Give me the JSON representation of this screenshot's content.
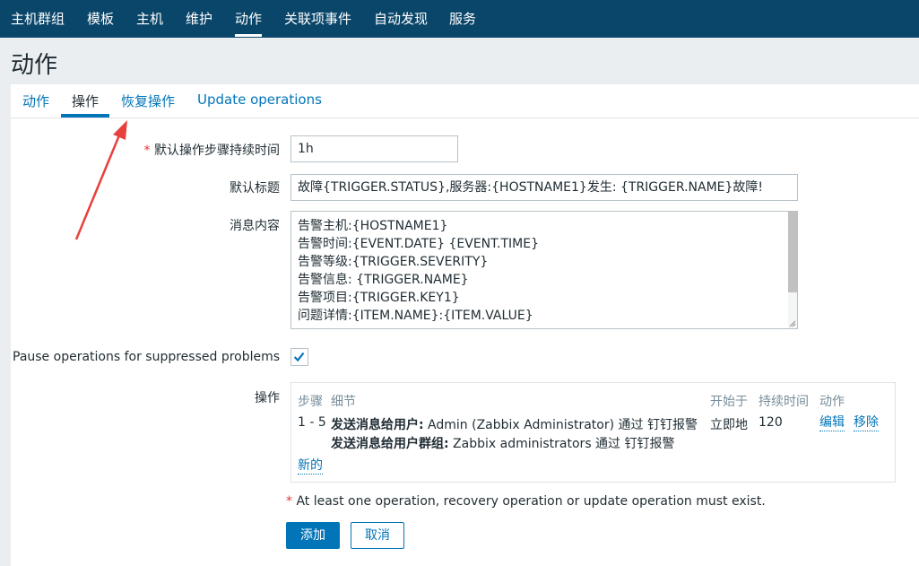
{
  "topnav": {
    "items": [
      "主机群组",
      "模板",
      "主机",
      "维护",
      "动作",
      "关联项事件",
      "自动发现",
      "服务"
    ],
    "active_index": 4
  },
  "page": {
    "title": "动作"
  },
  "tabs": {
    "items": [
      "动作",
      "操作",
      "恢复操作",
      "Update operations"
    ],
    "active_index": 1
  },
  "form": {
    "step_duration": {
      "required_mark": "*",
      "label": "默认操作步骤持续时间",
      "value": "1h"
    },
    "default_subject": {
      "label": "默认标题",
      "value": "故障{TRIGGER.STATUS},服务器:{HOSTNAME1}发生: {TRIGGER.NAME}故障!"
    },
    "message": {
      "label": "消息内容",
      "lines": [
        "告警主机:{HOSTNAME1}",
        "告警时间:{EVENT.DATE} {EVENT.TIME}",
        "告警等级:{TRIGGER.SEVERITY}",
        "告警信息: {TRIGGER.NAME}",
        "告警项目:{TRIGGER.KEY1}",
        "问题详情:{ITEM.NAME}:{ITEM.VALUE}"
      ]
    },
    "pause": {
      "label": "Pause operations for suppressed problems",
      "checked": true
    },
    "operations": {
      "label": "操作",
      "columns": {
        "steps": "步骤",
        "details": "细节",
        "start_in": "开始于",
        "duration": "持续时间",
        "action": "动作"
      },
      "rows": [
        {
          "steps": "1 - 5",
          "detail_1_bold": "发送消息给用户:",
          "detail_1_text": " Admin (Zabbix Administrator) 通过 钉钉报警",
          "detail_2_bold": "发送消息给用户群组:",
          "detail_2_text": " Zabbix administrators 通过 钉钉报警",
          "start_in": "立即地",
          "duration": "120",
          "edit": "编辑",
          "remove": "移除"
        }
      ],
      "new_link": "新的"
    },
    "warning": {
      "required_mark": "*",
      "text": " At least one operation, recovery operation or update operation must exist."
    }
  },
  "buttons": {
    "add": "添加",
    "cancel": "取消"
  },
  "colors": {
    "nav_bg": "#0a466a",
    "link": "#0275b8",
    "required": "#e33734",
    "annotation_arrow": "#e8403c"
  }
}
